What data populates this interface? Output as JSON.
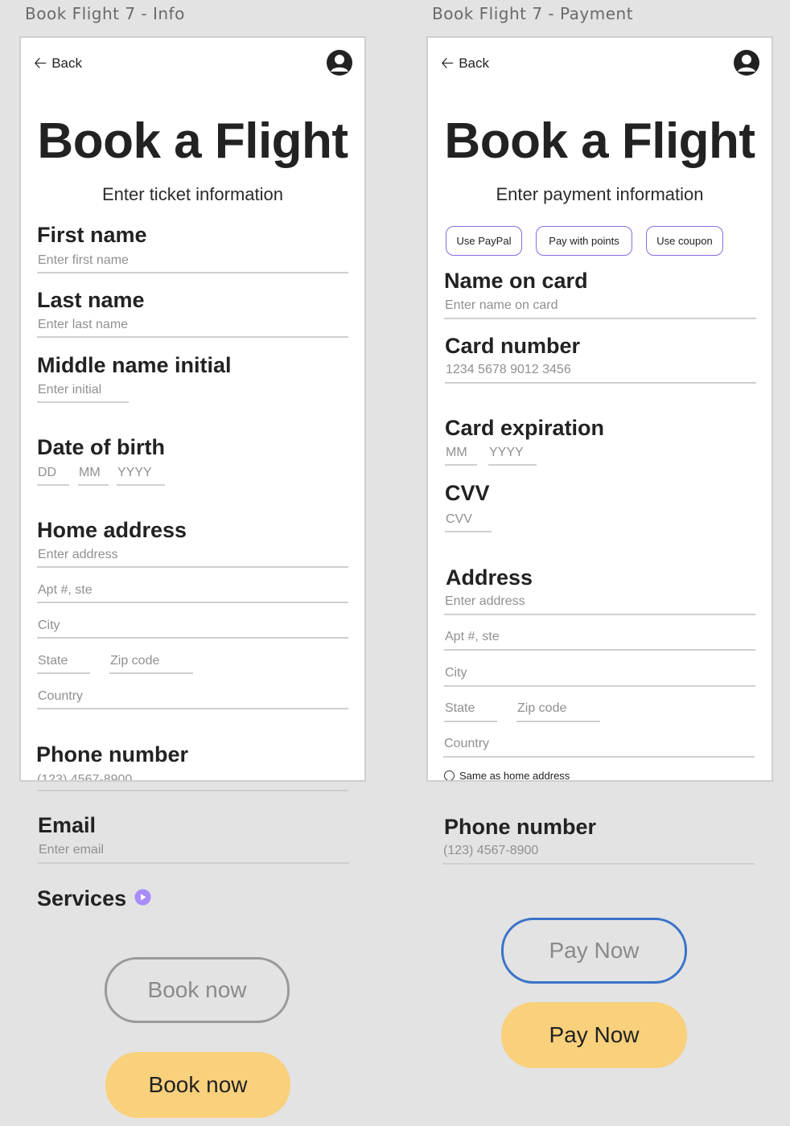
{
  "info": {
    "frame_title": "Book Flight 7 - Info",
    "back_label": "Back",
    "title": "Book a Flight",
    "subtitle": "Enter ticket information",
    "first_name": {
      "label": "First name",
      "placeholder": "Enter first name"
    },
    "last_name": {
      "label": "Last name",
      "placeholder": "Enter last name"
    },
    "middle_initial": {
      "label": "Middle name initial",
      "placeholder": "Enter initial"
    },
    "dob": {
      "label": "Date of birth",
      "day": "DD",
      "month": "MM",
      "year": "YYYY"
    },
    "address": {
      "label": "Home address",
      "line1": "Enter address",
      "line2": "Apt #, ste",
      "city": "City",
      "state": "State",
      "zip": "Zip code",
      "country": "Country"
    },
    "phone": {
      "label": "Phone number",
      "placeholder": "(123) 4567-8900"
    },
    "email": {
      "label": "Email",
      "placeholder": "Enter email"
    },
    "services_label": "Services",
    "book_outline_label": "Book now",
    "book_fill_label": "Book now"
  },
  "payment": {
    "frame_title": "Book Flight 7 - Payment",
    "back_label": "Back",
    "title": "Book a Flight",
    "subtitle": "Enter payment information",
    "options": [
      "Use PayPal",
      "Pay with points",
      "Use coupon"
    ],
    "name_on_card": {
      "label": "Name on card",
      "placeholder": "Enter name on card"
    },
    "card_number": {
      "label": "Card number",
      "placeholder": "1234 5678 9012 3456"
    },
    "expiration": {
      "label": "Card expiration",
      "month": "MM",
      "year": "YYYY"
    },
    "cvv": {
      "label": "CVV",
      "placeholder": "CVV"
    },
    "address": {
      "label": "Address",
      "line1": "Enter address",
      "line2": "Apt #, ste",
      "city": "City",
      "state": "State",
      "zip": "Zip code",
      "country": "Country"
    },
    "same_as_home": "Same as home address",
    "phone": {
      "label": "Phone number",
      "placeholder": "(123) 4567-8900"
    },
    "pay_outline_label": "Pay Now",
    "pay_fill_label": "Pay Now"
  },
  "colors": {
    "background": "#e3e3e3",
    "accent_yellow": "#f9d07c",
    "chip_border": "#8a6be0",
    "focus_blue": "#3a73c9",
    "services_icon": "#a78bfa"
  },
  "icons": {
    "back": "arrow-left-icon",
    "profile": "user-circle-icon",
    "services": "play-circle-icon",
    "radio": "radio-unchecked-icon"
  }
}
